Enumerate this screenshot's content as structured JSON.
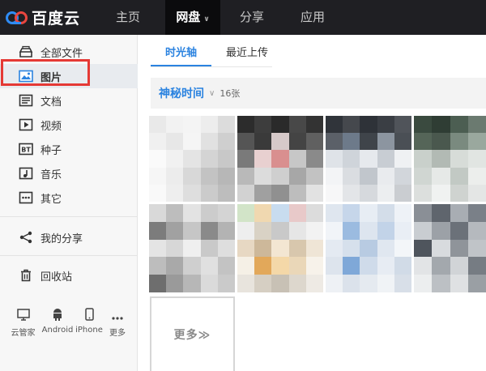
{
  "app": {
    "logo_text": "百度云"
  },
  "nav": [
    {
      "label": "主页"
    },
    {
      "label": "网盘"
    },
    {
      "label": "分享"
    },
    {
      "label": "应用"
    }
  ],
  "sidebar": {
    "items": [
      {
        "label": "全部文件",
        "icon": "folder-icon"
      },
      {
        "label": "图片",
        "icon": "image-icon"
      },
      {
        "label": "文档",
        "icon": "document-icon"
      },
      {
        "label": "视频",
        "icon": "video-icon"
      },
      {
        "label": "种子",
        "icon": "bt-icon",
        "icon_text": "BT"
      },
      {
        "label": "音乐",
        "icon": "music-icon"
      },
      {
        "label": "其它",
        "icon": "more-dots-icon"
      },
      {
        "label": "我的分享",
        "icon": "share-icon"
      },
      {
        "label": "回收站",
        "icon": "trash-icon"
      }
    ],
    "selected": "图片",
    "highlight_color": "#e53935",
    "tools": [
      {
        "label": "云管家",
        "icon": "monitor-icon"
      },
      {
        "label": "Android",
        "icon": "android-icon"
      },
      {
        "label": "iPhone",
        "icon": "iphone-icon"
      },
      {
        "label": "更多",
        "icon": "ellipsis-icon"
      }
    ]
  },
  "tabs": [
    {
      "label": "时光轴"
    },
    {
      "label": "最近上传"
    }
  ],
  "timeline": {
    "title": "神秘时间",
    "count": "16张"
  },
  "more_tile": {
    "label": "更多≫"
  },
  "colors": {
    "accent": "#2b83e0",
    "topbar": "#1f1f23"
  }
}
